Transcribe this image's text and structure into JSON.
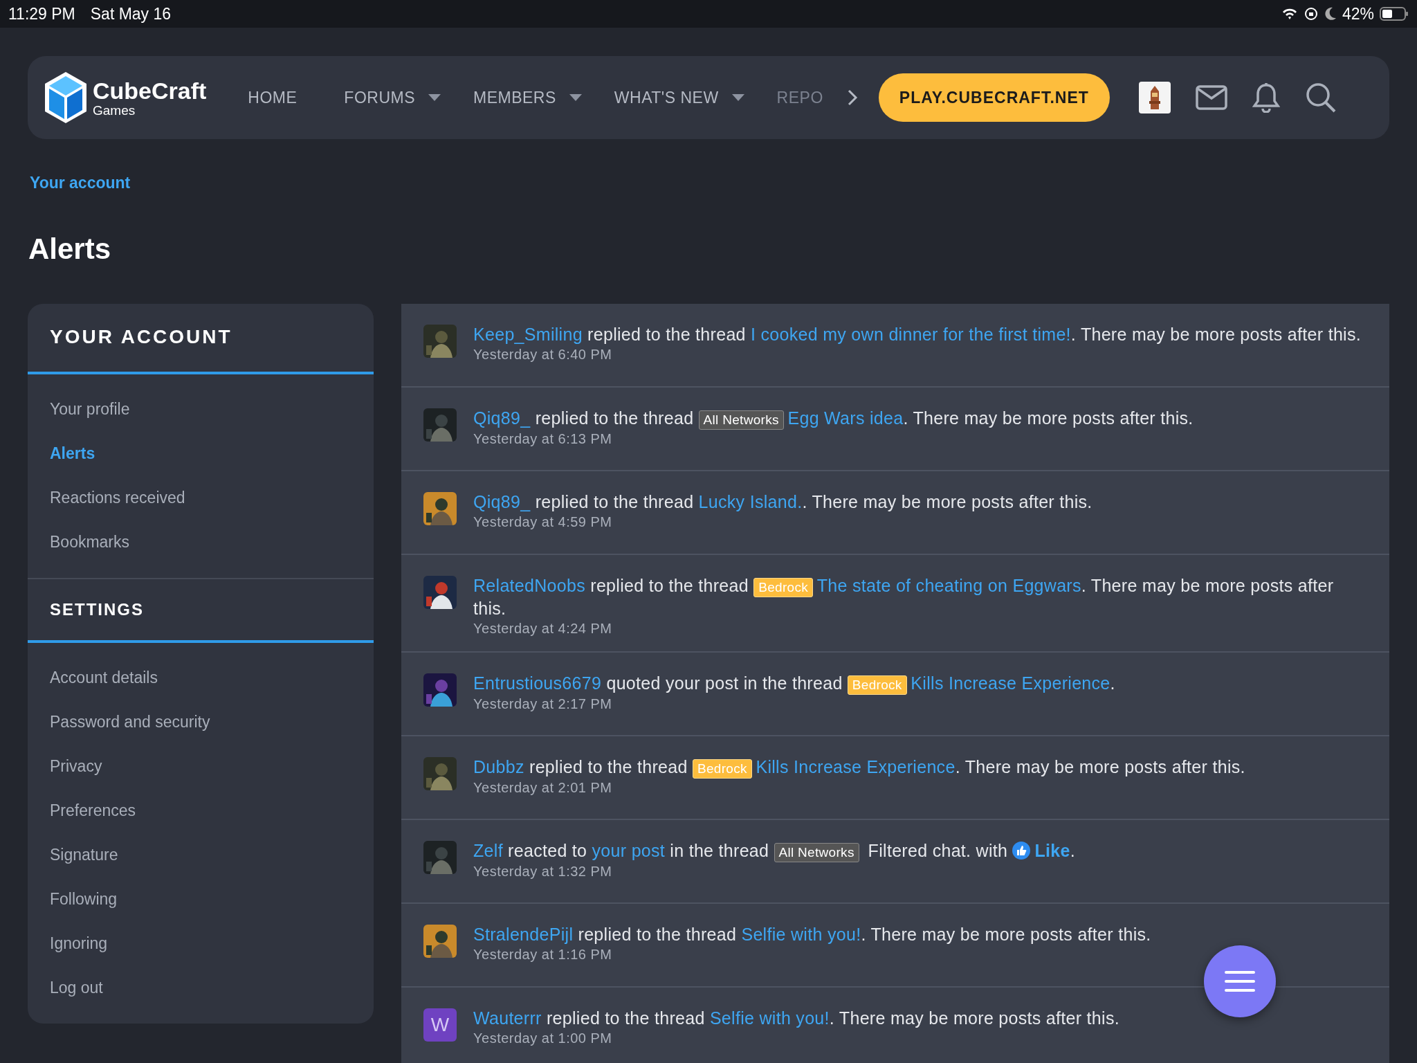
{
  "status_bar": {
    "time": "11:29 PM",
    "date": "Sat May 16",
    "battery": "42%"
  },
  "header": {
    "logo": {
      "name": "CubeCraft",
      "sub": "Games"
    },
    "nav": [
      {
        "label": "HOME",
        "dropdown": false,
        "faded": false
      },
      {
        "label": "FORUMS",
        "dropdown": true,
        "faded": false
      },
      {
        "label": "MEMBERS",
        "dropdown": true,
        "faded": false
      },
      {
        "label": "WHAT'S NEW",
        "dropdown": true,
        "faded": false
      },
      {
        "label": "REPO",
        "dropdown": false,
        "faded": true
      }
    ],
    "cta": "PLAY.CUBECRAFT.NET"
  },
  "breadcrumb": "Your account",
  "title": "Alerts",
  "sidebar": [
    {
      "title": "YOUR ACCOUNT",
      "items": [
        {
          "label": "Your profile",
          "selected": false
        },
        {
          "label": "Alerts",
          "selected": true
        },
        {
          "label": "Reactions received",
          "selected": false
        },
        {
          "label": "Bookmarks",
          "selected": false
        }
      ]
    },
    {
      "title": "SETTINGS",
      "items": [
        {
          "label": "Account details",
          "selected": false
        },
        {
          "label": "Password and security",
          "selected": false
        },
        {
          "label": "Privacy",
          "selected": false
        },
        {
          "label": "Preferences",
          "selected": false
        },
        {
          "label": "Signature",
          "selected": false
        },
        {
          "label": "Following",
          "selected": false
        },
        {
          "label": "Ignoring",
          "selected": false
        },
        {
          "label": "Log out",
          "selected": false
        }
      ]
    }
  ],
  "alerts": [
    {
      "avatar": {
        "kind": "picture"
      },
      "time": "Yesterday at 6:40 PM",
      "parts": [
        {
          "kind": "user",
          "text": "Keep_Smiling"
        },
        {
          "kind": "text",
          "text": " replied to the thread "
        },
        {
          "kind": "link",
          "text": "I cooked my own dinner for the first time!"
        },
        {
          "kind": "text",
          "text": ". There may be more posts after this."
        }
      ]
    },
    {
      "avatar": {
        "kind": "picture"
      },
      "time": "Yesterday at 6:13 PM",
      "parts": [
        {
          "kind": "user",
          "text": "Qiq89_"
        },
        {
          "kind": "text",
          "text": " replied to the thread "
        },
        {
          "kind": "tag",
          "text": "All Networks",
          "color": "#555555"
        },
        {
          "kind": "link",
          "text": "Egg Wars idea"
        },
        {
          "kind": "text",
          "text": ". There may be more posts after this."
        }
      ]
    },
    {
      "avatar": {
        "kind": "picture"
      },
      "time": "Yesterday at 4:59 PM",
      "parts": [
        {
          "kind": "user",
          "text": "Qiq89_"
        },
        {
          "kind": "text",
          "text": " replied to the thread "
        },
        {
          "kind": "link",
          "text": "Lucky Island."
        },
        {
          "kind": "text",
          "text": ". There may be more posts after this."
        }
      ]
    },
    {
      "avatar": {
        "kind": "picture"
      },
      "time": "Yesterday at 4:24 PM",
      "parts": [
        {
          "kind": "user",
          "text": "RelatedNoobs"
        },
        {
          "kind": "text",
          "text": " replied to the thread "
        },
        {
          "kind": "tag",
          "text": "Bedrock",
          "color": "#fdbd3d"
        },
        {
          "kind": "link",
          "text": "The state of cheating on Eggwars"
        },
        {
          "kind": "text",
          "text": ". There may be more posts after this."
        }
      ]
    },
    {
      "avatar": {
        "kind": "picture"
      },
      "time": "Yesterday at 2:17 PM",
      "parts": [
        {
          "kind": "user",
          "text": "Entrustious6679"
        },
        {
          "kind": "text",
          "text": " quoted your post in the thread "
        },
        {
          "kind": "tag",
          "text": "Bedrock",
          "color": "#fdbd3d"
        },
        {
          "kind": "link",
          "text": "Kills Increase Experience"
        },
        {
          "kind": "text",
          "text": "."
        }
      ]
    },
    {
      "avatar": {
        "kind": "picture"
      },
      "time": "Yesterday at 2:01 PM",
      "parts": [
        {
          "kind": "user",
          "text": "Dubbz"
        },
        {
          "kind": "text",
          "text": " replied to the thread "
        },
        {
          "kind": "tag",
          "text": "Bedrock",
          "color": "#fdbd3d"
        },
        {
          "kind": "link",
          "text": "Kills Increase Experience"
        },
        {
          "kind": "text",
          "text": ". There may be more posts after this."
        }
      ]
    },
    {
      "avatar": {
        "kind": "picture"
      },
      "time": "Yesterday at 1:32 PM",
      "parts": [
        {
          "kind": "user",
          "text": "Zelf"
        },
        {
          "kind": "text",
          "text": " reacted to "
        },
        {
          "kind": "link",
          "text": "your post"
        },
        {
          "kind": "text",
          "text": " in the thread "
        },
        {
          "kind": "tag",
          "text": "All Networks",
          "color": "#555555"
        },
        {
          "kind": "text",
          "text": " Filtered chat. with "
        },
        {
          "kind": "reaction",
          "text": "Like"
        },
        {
          "kind": "text",
          "text": "."
        }
      ]
    },
    {
      "avatar": {
        "kind": "picture"
      },
      "time": "Yesterday at 1:16 PM",
      "parts": [
        {
          "kind": "user",
          "text": "StralendePijl"
        },
        {
          "kind": "text",
          "text": " replied to the thread "
        },
        {
          "kind": "link",
          "text": "Selfie with you!"
        },
        {
          "kind": "text",
          "text": ". There may be more posts after this."
        }
      ]
    },
    {
      "avatar": {
        "kind": "letter",
        "letter": "W",
        "color": "#6f42c1"
      },
      "time": "Yesterday at 1:00 PM",
      "parts": [
        {
          "kind": "user",
          "text": "Wauterrr"
        },
        {
          "kind": "text",
          "text": " replied to the thread "
        },
        {
          "kind": "link",
          "text": "Selfie with you!"
        },
        {
          "kind": "text",
          "text": ". There may be more posts after this."
        }
      ]
    }
  ]
}
